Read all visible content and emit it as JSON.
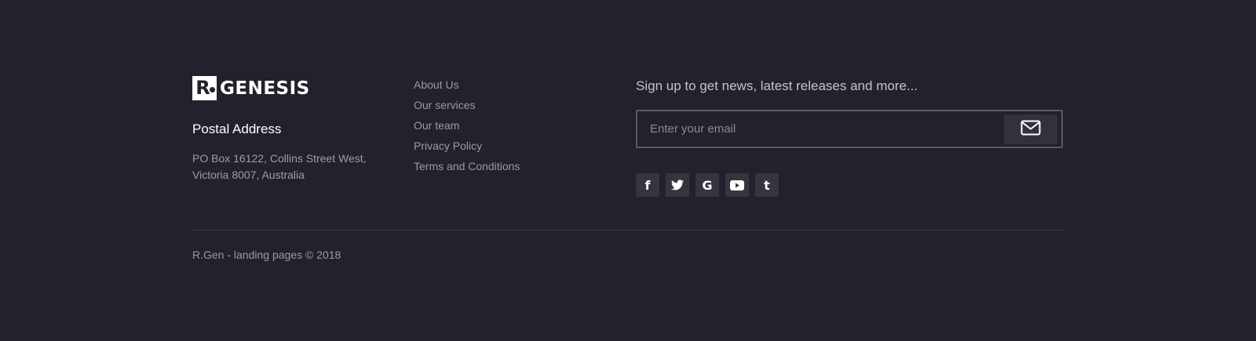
{
  "logo": {
    "mark": "R",
    "text": "GENESIS"
  },
  "address": {
    "title": "Postal Address",
    "line1": "PO Box 16122, Collins Street West,",
    "line2": "Victoria 8007, Australia"
  },
  "links": [
    "About Us",
    "Our services",
    "Our team",
    "Privacy Policy",
    "Terms and Conditions"
  ],
  "signup": {
    "text": "Sign up to get news, latest releases and more...",
    "placeholder": "Enter your email",
    "submit_icon": "envelope-icon"
  },
  "social": [
    {
      "icon": "facebook-icon",
      "glyph": "f"
    },
    {
      "icon": "twitter-icon",
      "glyph": "t"
    },
    {
      "icon": "google-icon",
      "glyph": "G"
    },
    {
      "icon": "youtube-icon",
      "glyph": "▶"
    },
    {
      "icon": "tumblr-icon",
      "glyph": "t"
    }
  ],
  "copyright": "R.Gen - landing pages © 2018"
}
